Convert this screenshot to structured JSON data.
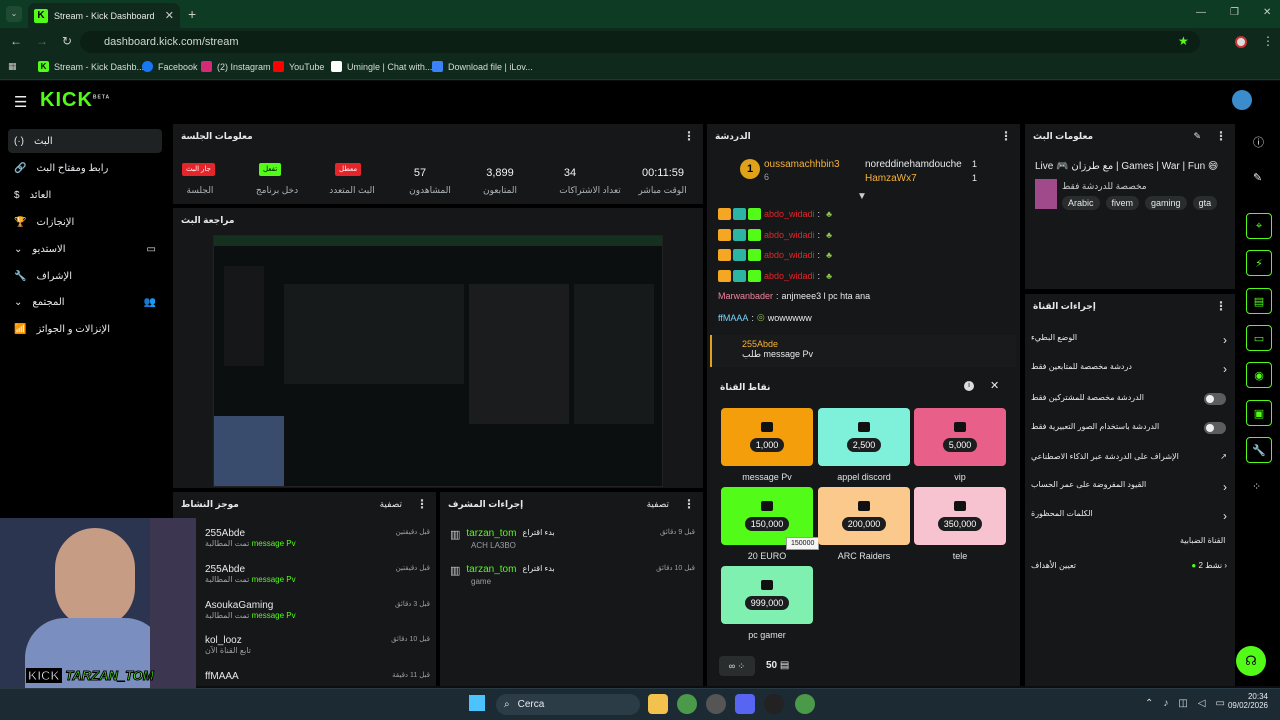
{
  "browser": {
    "tab_title": "Stream - Kick Dashboard",
    "url": "dashboard.kick.com/stream",
    "bookmarks": [
      "Stream - Kick Dashb...",
      "Facebook",
      "(2) Instagram",
      "YouTube",
      "Umingle | Chat with...",
      "Download file | iLov..."
    ]
  },
  "app": {
    "logo": "KICK",
    "beta": "BETA"
  },
  "sidebar": {
    "items": [
      {
        "label": "البث",
        "icon": "(·)"
      },
      {
        "label": "رابط ومفتاح البث",
        "icon": "🔗"
      },
      {
        "label": "العائد",
        "icon": "$"
      },
      {
        "label": "الإنجازات",
        "icon": "🏆"
      },
      {
        "label": "الاستديو",
        "icon": "▭"
      },
      {
        "label": "الإشراف",
        "icon": "🔧"
      },
      {
        "label": "المجتمع",
        "icon": "👥"
      },
      {
        "label": "الإنزالات و الجوائز",
        "icon": "📶"
      }
    ]
  },
  "session": {
    "title": "معلومات الجلسة",
    "badges": [
      {
        "text": "جار البث",
        "label": "الجلسة",
        "color": "red"
      },
      {
        "text": "تفعل",
        "label": "دخل برنامج",
        "color": "green"
      },
      {
        "text": "معطل",
        "label": "البث المتعدد",
        "color": "red"
      }
    ],
    "stats": [
      {
        "value": "57",
        "label": "المشاهدون"
      },
      {
        "value": "3,899",
        "label": "المتابعون"
      },
      {
        "value": "34",
        "label": "تعداد الاشتراكات"
      },
      {
        "value": "00:11:59",
        "label": "الوقت مباشر"
      }
    ]
  },
  "preview": {
    "title": "مراجعة البث"
  },
  "chat": {
    "title": "الدردشة",
    "top": [
      {
        "name": "oussamachhbin3",
        "count": "6"
      },
      {
        "name": "noreddinehamdouche",
        "count": "1"
      },
      {
        "name": "HamzaWx7",
        "count": "1"
      }
    ],
    "lines": [
      {
        "user": "abdo_widadi",
        "text": ""
      },
      {
        "user": "abdo_widadi",
        "text": ""
      },
      {
        "user": "abdo_widadi",
        "text": ""
      },
      {
        "user": "abdo_widadi",
        "text": ""
      },
      {
        "user": "Marwanbader",
        "text": "anjmeee3 l pc hta ana"
      },
      {
        "user": "ffMAAA",
        "text": "wowwwww"
      }
    ],
    "highlight": {
      "user": "255Abde",
      "text": "طلب message Pv"
    }
  },
  "points": {
    "title": "نقاط القناة",
    "rewards": [
      {
        "cost": "1,000",
        "label": "message Pv",
        "color": "#f59e0b"
      },
      {
        "cost": "2,500",
        "label": "appel discord",
        "color": "#7ff0da"
      },
      {
        "cost": "5,000",
        "label": "vip",
        "color": "#e8608a"
      },
      {
        "cost": "150,000",
        "label": "20 EURO",
        "color": "#53fc18"
      },
      {
        "cost": "200,000",
        "label": "ARC Raiders",
        "color": "#fbc98c"
      },
      {
        "cost": "350,000",
        "label": "tele",
        "color": "#f8c3d0"
      },
      {
        "cost": "999,000",
        "label": "pc gamer",
        "color": "#7ff0b0"
      }
    ],
    "tooltip": "150000",
    "balance": "50"
  },
  "activity": {
    "title": "موجز النشاط",
    "filter": "تصفية",
    "items": [
      {
        "user": "255Abde",
        "sub": "تمت المطالبة",
        "reward": "message Pv",
        "time": "قبل دقيقتين"
      },
      {
        "user": "255Abde",
        "sub": "تمت المطالبة",
        "reward": "message Pv",
        "time": "قبل دقيقتين"
      },
      {
        "user": "AsoukaGaming",
        "sub": "تمت المطالبة",
        "reward": "message Pv",
        "time": "قبل 3 دقائق"
      },
      {
        "user": "kol_looz",
        "sub": "تابع القناة الآن",
        "reward": "",
        "time": "قبل 10 دقائق"
      },
      {
        "user": "ffMAAA",
        "sub": "",
        "reward": "",
        "time": "قبل 11 دقيقة"
      }
    ]
  },
  "modactions": {
    "title": "إجراءات المشرف",
    "filter": "تصفية",
    "items": [
      {
        "user": "tarzan_tom",
        "action": "بدء اقتراع",
        "detail": "ACH LA3BO",
        "time": "قبل 9 دقائق"
      },
      {
        "user": "tarzan_tom",
        "action": "بدء اقتراع",
        "detail": "game",
        "time": "قبل 10 دقائق"
      }
    ]
  },
  "streaminfo": {
    "title": "معلومات البث",
    "stream_title": "Live 🎮 مع طرزان | Games | War | Fun 😄",
    "category": "مخصصة للدردشة فقط",
    "tags": [
      "Arabic",
      "fivem",
      "gaming",
      "gta"
    ]
  },
  "channel": {
    "title": "إجراءات القناة",
    "items": [
      {
        "label": "الوضع البطيء",
        "ctrl": "chevron"
      },
      {
        "label": "دردشة مخصصة للمتابعين فقط",
        "ctrl": "chevron"
      },
      {
        "label": "الدردشة مخصصة للمشتركين فقط",
        "ctrl": "toggle"
      },
      {
        "label": "الدردشة باستخدام الصور التعبيرية فقط",
        "ctrl": "toggle"
      },
      {
        "label": "الإشراف على الدردشة عبر الذكاء الاصطناعي",
        "ctrl": "ext"
      },
      {
        "label": "القيود المفروضة على عمر الحساب",
        "ctrl": "chevron"
      },
      {
        "label": "الكلمات المحظورة",
        "ctrl": "chevron"
      }
    ],
    "shield": "القناة الضبابية",
    "goals": "تعيين الأهداف",
    "goals_status": "نشط 2"
  },
  "webcam": {
    "name": "TARZAN_TOM",
    "logo": "KICK"
  },
  "taskbar": {
    "search": "Cerca",
    "time": "20:34",
    "date": "09/02/2026"
  }
}
